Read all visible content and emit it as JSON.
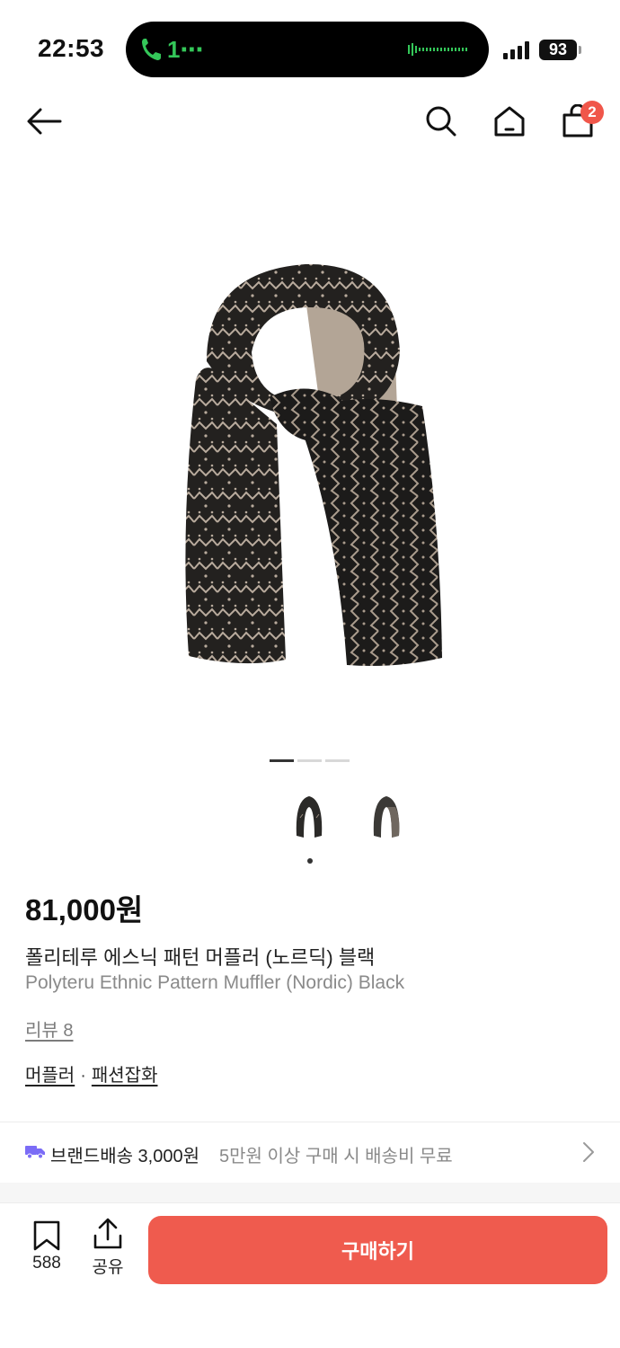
{
  "status_bar": {
    "time": "22:53",
    "call_text": "1⋯",
    "battery": "93",
    "call_color": "#34c759"
  },
  "nav": {
    "icons": [
      "back-arrow-icon",
      "search-icon",
      "home-icon",
      "shopping-bag-icon"
    ],
    "cart_badge": "2",
    "badge_color": "#f0564a"
  },
  "gallery": {
    "indicators": 3,
    "active_indicator": 0,
    "thumbnails": 2,
    "selected_thumbnail": 0
  },
  "product": {
    "price": "81,000원",
    "name_ko": "폴리테루 에스닉 패턴 머플러 (노르딕) 블랙",
    "name_en": "Polyteru Ethnic Pattern Muffler (Nordic) Black",
    "review": "리뷰 8",
    "category_1": "머플러",
    "category_sep": "·",
    "category_2": "패션잡화"
  },
  "shipping": {
    "brand_label": "브랜드배송 3,000원",
    "free_note": "5만원 이상 구매 시 배송비 무료",
    "truck_color": "#7b6cf6"
  },
  "bottom_bar": {
    "bookmark_count": "588",
    "share_label": "공유",
    "buy_label": "구매하기",
    "buy_color": "#ef5b4e"
  }
}
